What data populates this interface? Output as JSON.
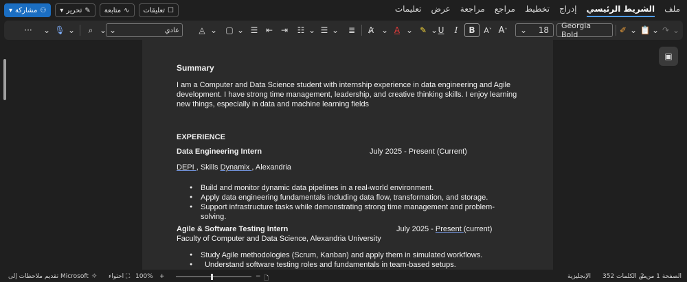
{
  "menu": {
    "tabs": [
      "ملف",
      "الشريط الرئيسي",
      "إدراج",
      "تخطيط",
      "مراجع",
      "مراجعة",
      "عرض",
      "تعليمات"
    ],
    "active": "الشريط الرئيسي"
  },
  "actions": {
    "share": "مشاركة",
    "edit": "تحرير",
    "follow": "متابعة",
    "comments": "تعليقات"
  },
  "ribbon": {
    "font_name": "Georgia Bold",
    "font_size": "18",
    "style": "عادي",
    "grow_font": "A",
    "shrink_font": "A",
    "bold": "B",
    "italic": "I",
    "underline": "U",
    "more": "···"
  },
  "colors": {
    "accent": "#4f9cf5",
    "share_bg": "#1b6ec2",
    "font_color": "#e03a3a",
    "highlight": "#f2d33a"
  },
  "document": {
    "summary_heading": "Summary",
    "summary_text_1": "I am a Computer and Data Science student with internship experience in data engineering and Agile",
    "summary_text_2": "development. I have strong time management, leadership, and creative thinking skills. I enjoy learning",
    "summary_text_3": "new things, especially in data and machine learning fields",
    "experience_heading": "EXPERIENCE",
    "job1": {
      "title": "Data Engineering Intern",
      "dates": "July 2025 - Present (Current)",
      "org_a": "DEPI ",
      "org_b": ", Skills ",
      "org_c": "Dynamix ",
      "org_d": ", Alexandria",
      "bullets": [
        "Build and monitor dynamic data pipelines in a real-world environment.",
        "Apply data engineering fundamentals including data flow, transformation, and storage.",
        "Support infrastructure tasks while demonstrating strong time management and problem-solving."
      ]
    },
    "job2": {
      "title": "Agile & Software Testing Intern",
      "dates_a": "July 2025 - ",
      "dates_b": "Present ",
      "dates_c": " (current)",
      "org": "Faculty of Computer and Data Science, Alexandria University",
      "bullets": [
        "Study Agile methodologies (Scrum, Kanban) and apply them in simulated workflows.",
        "  Understand software testing roles and fundamentals in team-based setups."
      ]
    }
  },
  "status": {
    "page": "الصفحة 1 من 2",
    "words": "352 من الكلمات",
    "language": "الإنجليزية",
    "zoom": "100%",
    "fit": "احتواء",
    "feedback": "تقديم ملاحظات إلى Microsoft"
  }
}
